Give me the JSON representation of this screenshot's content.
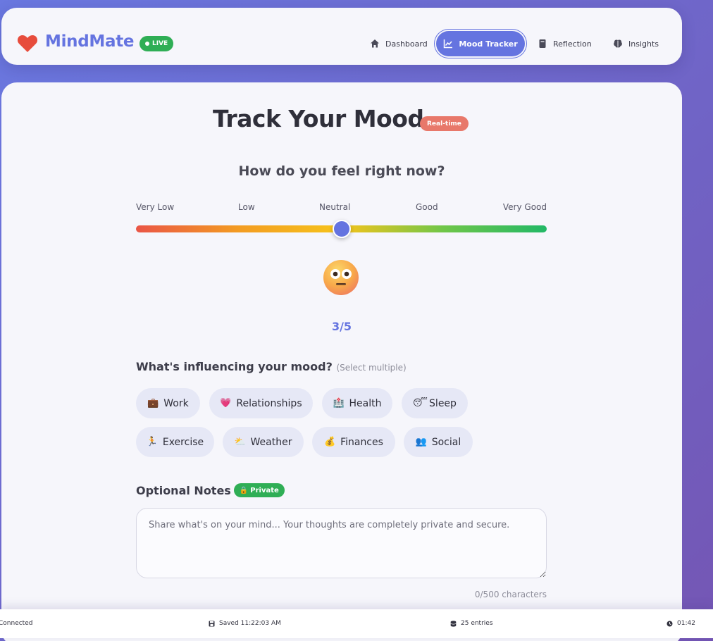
{
  "app": {
    "name": "MindMate",
    "live_label": "LIVE"
  },
  "nav": {
    "items": [
      {
        "label": "Dashboard",
        "icon": "home-icon"
      },
      {
        "label": "Mood Tracker",
        "icon": "chart-line-icon",
        "active": true
      },
      {
        "label": "Reflection",
        "icon": "book-icon"
      },
      {
        "label": "Insights",
        "icon": "brain-icon"
      }
    ]
  },
  "tracker": {
    "title": "Track Your Mood",
    "realtime_badge": "Real-time",
    "question": "How do you feel right now?",
    "scale_labels": [
      "Very Low",
      "Low",
      "Neutral",
      "Good",
      "Very Good"
    ],
    "mood_value": 3,
    "mood_max": 5,
    "mood_score_text": "3/5",
    "mood_emoji": "neutral-face-icon"
  },
  "influences": {
    "heading": "What's influencing your mood?",
    "hint": "(Select multiple)",
    "chips": [
      {
        "label": "Work",
        "icon": "briefcase-icon"
      },
      {
        "label": "Relationships",
        "icon": "heart-icon"
      },
      {
        "label": "Health",
        "icon": "health-icon"
      },
      {
        "label": "Sleep",
        "icon": "sleepy-face-icon"
      },
      {
        "label": "Exercise",
        "icon": "running-icon"
      },
      {
        "label": "Weather",
        "icon": "sun-cloud-icon"
      },
      {
        "label": "Finances",
        "icon": "money-bag-icon"
      },
      {
        "label": "Social",
        "icon": "people-icon"
      }
    ]
  },
  "notes": {
    "heading": "Optional Notes",
    "private_badge": "Private",
    "placeholder": "Share what's on your mind... Your thoughts are completely private and secure.",
    "value": "",
    "char_count": "0/500 characters"
  },
  "status": {
    "connection": "Connected",
    "saved": "Saved 11:22:03 AM",
    "entries": "25 entries",
    "timer": "01:42"
  },
  "colors": {
    "accent": "#6574e0",
    "live": "#2fae55",
    "realtime": "#e8786a",
    "heart": "#e74c3c"
  }
}
